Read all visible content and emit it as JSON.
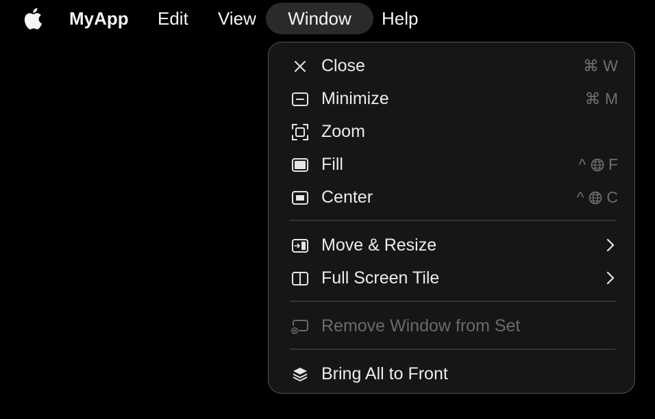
{
  "menubar": {
    "apple_icon": "apple-logo-icon",
    "app_name": "MyApp",
    "items": [
      "Edit",
      "View",
      "Window",
      "Help"
    ]
  },
  "window_menu": {
    "items": [
      {
        "label": "Close",
        "icon": "close-x-icon",
        "shortcut": "⌘ W"
      },
      {
        "label": "Minimize",
        "icon": "minimize-window-icon",
        "shortcut": "⌘ M"
      },
      {
        "label": "Zoom",
        "icon": "zoom-frame-icon",
        "shortcut": ""
      },
      {
        "label": "Fill",
        "icon": "fill-window-icon",
        "shortcut_prefix": "^",
        "shortcut_key": "F"
      },
      {
        "label": "Center",
        "icon": "center-window-icon",
        "shortcut_prefix": "^",
        "shortcut_key": "C"
      },
      {
        "label": "Move & Resize",
        "icon": "move-resize-icon",
        "submenu": true
      },
      {
        "label": "Full Screen Tile",
        "icon": "split-view-icon",
        "submenu": true
      },
      {
        "label": "Remove Window from Set",
        "icon": "remove-window-icon",
        "disabled": true
      },
      {
        "label": "Bring All to Front",
        "icon": "layers-stack-icon"
      }
    ]
  },
  "colors": {
    "background": "#000000",
    "menu_bg": "#161616",
    "menu_border": "#555555",
    "highlight": "#2a2a2a",
    "text": "#ececec",
    "disabled_text": "#6a6a6a",
    "shortcut_text": "#6f6f6f"
  }
}
